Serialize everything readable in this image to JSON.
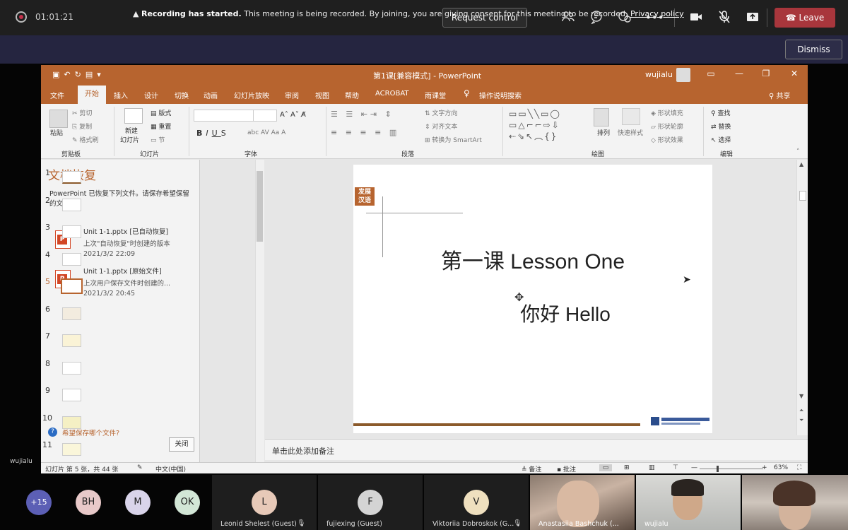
{
  "teams": {
    "timer": "01:01:21",
    "request_control": "Request control",
    "leave": "Leave",
    "banner_bold": "Recording has started.",
    "banner_text": " This meeting is being recorded. By joining, you are giving consent for this meeting to be recorded. ",
    "banner_link": "Privacy policy",
    "dismiss": "Dismiss",
    "self_label": "wujialu",
    "more_count": "+15"
  },
  "ppt": {
    "title": "第1课[兼容模式] - PowerPoint",
    "user": "wujialu",
    "tabs": [
      "文件",
      "开始",
      "插入",
      "设计",
      "切换",
      "动画",
      "幻灯片放映",
      "审阅",
      "视图",
      "帮助",
      "ACROBAT",
      "雨课堂",
      "操作说明搜索"
    ],
    "share": "共享",
    "ribbon": {
      "paste": "粘贴",
      "cut": "剪切",
      "copy": "复制",
      "format_painter": "格式刷",
      "clipboard": "剪贴板",
      "new_slide": "新建",
      "new_slide2": "幻灯片",
      "layout": "版式",
      "reset": "重置",
      "section": "节",
      "slides": "幻灯片",
      "font": "字体",
      "paragraph": "段落",
      "text_direction": "文字方向",
      "align_text": "对齐文本",
      "smartart": "转换为 SmartArt",
      "arrange": "排列",
      "quick_styles": "快速样式",
      "shape_fill": "形状填充",
      "shape_outline": "形状轮廓",
      "shape_effects": "形状效果",
      "drawing": "绘图",
      "find": "查找",
      "replace": "替换",
      "select": "选择",
      "editing": "编辑"
    },
    "recovery": {
      "title": "文档恢复",
      "desc": "PowerPoint 已恢复下列文件。请保存希望保留的文件。",
      "files": [
        {
          "name": "Unit 1-1.pptx  [已自动恢复]",
          "sub": "上次\"自动恢复\"时创建的版本",
          "date": "2021/3/2 22:09"
        },
        {
          "name": "Unit 1-1.pptx  [原始文件]",
          "sub": "上次用户保存文件时创建的...",
          "date": "2021/3/2 20:45"
        }
      ],
      "help": "希望保存哪个文件?",
      "close": "关闭"
    },
    "thumbs": [
      "1",
      "2",
      "3",
      "4",
      "5",
      "6",
      "7",
      "8",
      "9",
      "10",
      "11"
    ],
    "slide": {
      "logo": "发展\n汉语",
      "title": "第一课 Lesson One",
      "subtitle": "你好  Hello"
    },
    "notes_placeholder": "单击此处添加备注",
    "status": {
      "slide_info": "幻灯片 第 5 张，共 44 张",
      "language": "中文(中国)",
      "notes": "备注",
      "comments": "批注",
      "zoom": "63%"
    }
  },
  "participants": [
    {
      "initials": "BH",
      "color": "#e8c9c9"
    },
    {
      "initials": "M",
      "color": "#d9d4ea"
    },
    {
      "initials": "OK",
      "color": "#d2e6d6"
    }
  ],
  "tiles": [
    {
      "initial": "L",
      "name": "Leonid Shelest (Guest)",
      "color": "#e7c9b8"
    },
    {
      "initial": "F",
      "name": "fujiexing (Guest)",
      "color": "#d4d4d4"
    },
    {
      "initial": "V",
      "name": "Viktoriia Dobroskok (G...",
      "color": "#efe0bf"
    }
  ],
  "video_tiles": [
    {
      "name": "Anastasiia Bashchuk (..."
    },
    {
      "name": "wujialu"
    }
  ]
}
